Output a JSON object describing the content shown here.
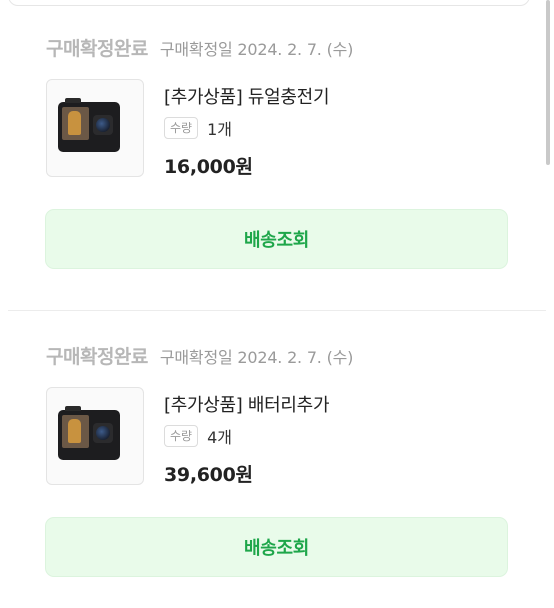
{
  "orders": [
    {
      "status": "구매확정완료",
      "date": "구매확정일 2024. 2. 7. (수)",
      "product_name": "[추가상품] 듀얼충전기",
      "qty_label": "수량",
      "qty_value": "1개",
      "price": "16,000원",
      "track_button": "배송조회",
      "thumbnail_icon": "action-camera-image"
    },
    {
      "status": "구매확정완료",
      "date": "구매확정일 2024. 2. 7. (수)",
      "product_name": "[추가상품] 배터리추가",
      "qty_label": "수량",
      "qty_value": "4개",
      "price": "39,600원",
      "track_button": "배송조회",
      "thumbnail_icon": "action-camera-image"
    }
  ],
  "colors": {
    "status_gray": "#b7b7b7",
    "button_bg": "#e9fbea",
    "button_text": "#1ea64a"
  }
}
